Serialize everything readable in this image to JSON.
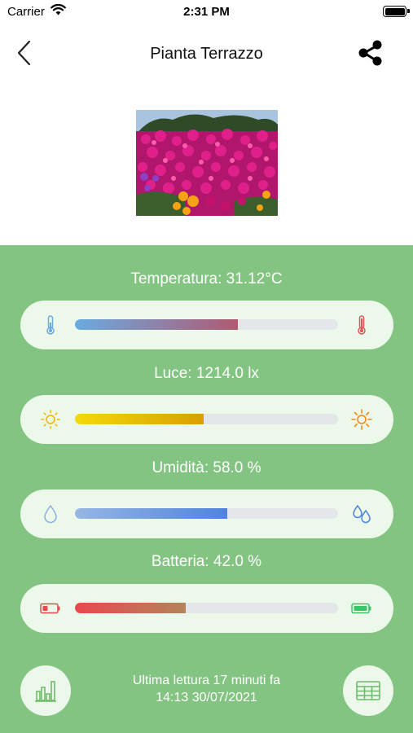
{
  "status_bar": {
    "carrier": "Carrier",
    "time": "2:31 PM"
  },
  "nav": {
    "title": "Pianta Terrazzo",
    "back_icon": "chevron-left-icon",
    "share_icon": "share-icon"
  },
  "photo": {
    "subject": "pink flowers"
  },
  "metrics": [
    {
      "label": "Temperatura: 31.12°C",
      "fraction": 0.62,
      "gradient": [
        "#6aabe0",
        "#b05a72"
      ],
      "icon_left": "thermometer-cold-icon",
      "icon_right": "thermometer-hot-icon"
    },
    {
      "label": "Luce: 1214.0 lx",
      "fraction": 0.49,
      "gradient": [
        "#f4d90c",
        "#d8a000"
      ],
      "icon_left": "sun-dim-icon",
      "icon_right": "sun-bright-icon"
    },
    {
      "label": "Umidità: 58.0 %",
      "fraction": 0.58,
      "gradient": [
        "#97b7e4",
        "#4f83dc"
      ],
      "icon_left": "water-drop-icon",
      "icon_right": "water-drops-icon"
    },
    {
      "label": "Batteria: 42.0 %",
      "fraction": 0.42,
      "gradient": [
        "#e8484e",
        "#b4845c"
      ],
      "icon_left": "battery-low-icon",
      "icon_right": "battery-full-icon"
    }
  ],
  "footer": {
    "last_reading": "Ultima lettura 17 minuti fa",
    "datetime": "14:13 30/07/2021",
    "chart_button_icon": "bar-chart-icon",
    "table_button_icon": "table-icon"
  }
}
